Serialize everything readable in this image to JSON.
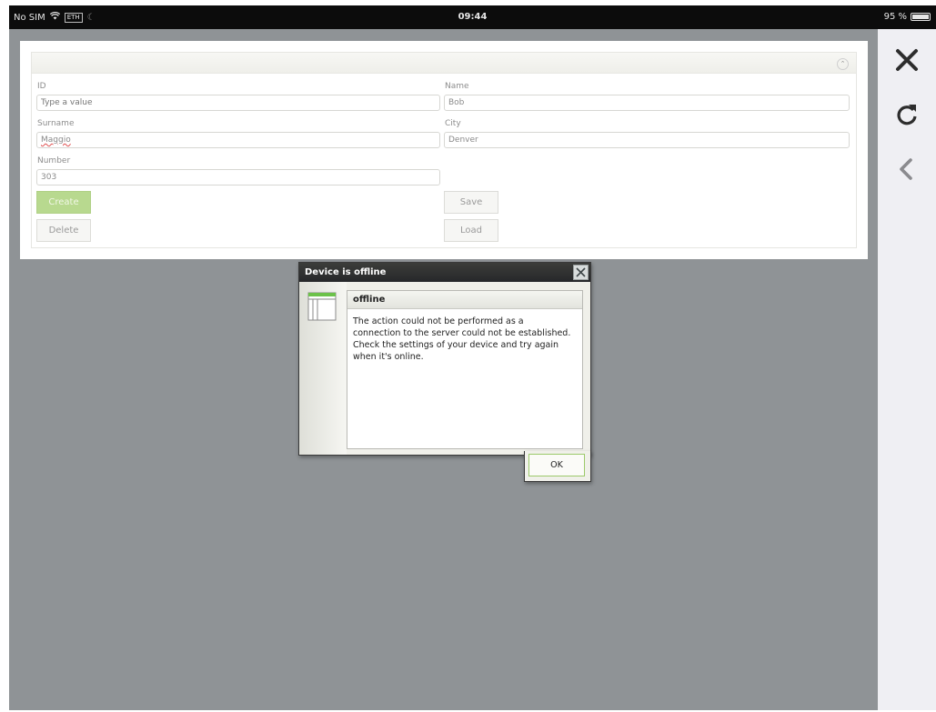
{
  "status_bar": {
    "carrier": "No SIM",
    "network_icon": "wifi-icon",
    "network_label": "ETH",
    "time": "09:44",
    "battery_text": "95 %",
    "battery_level": 0.95
  },
  "toolbar": {
    "close_icon": "close-icon",
    "reload_icon": "reload-icon",
    "back_icon": "back-chevron-icon"
  },
  "form": {
    "fields": {
      "id": {
        "label": "ID",
        "value": "",
        "placeholder": "Type a value"
      },
      "name": {
        "label": "Name",
        "value": "Bob"
      },
      "surname": {
        "label": "Surname",
        "value": "Maggio"
      },
      "city": {
        "label": "City",
        "value": "Denver"
      },
      "number": {
        "label": "Number",
        "value": "303"
      }
    },
    "buttons": {
      "create": "Create",
      "delete": "Delete",
      "save": "Save",
      "load": "Load"
    }
  },
  "dialog": {
    "title": "Device is offline",
    "heading": "offline",
    "message": "The action could not be performed as a connection to the server could not be established. Check the settings of your device and try again when it's online.",
    "ok_label": "OK"
  },
  "colors": {
    "primary_button": "#b8d98f",
    "background": "#8f9396",
    "dialog_titlebar": "#2f302e",
    "ok_border": "#9cc96a"
  }
}
